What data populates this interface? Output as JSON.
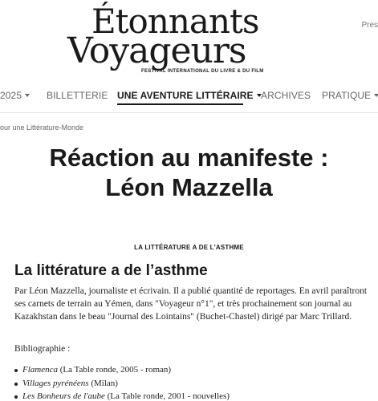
{
  "header": {
    "logo_line1": "Étonnants",
    "logo_line2": "Voyageurs",
    "logo_subtitle": "FESTIVAL INTERNATIONAL DU LIVRE & DU FILM",
    "press_link": "Pres"
  },
  "nav": {
    "items": [
      {
        "label": "2025",
        "dropdown": true
      },
      {
        "label": "BILLETTERIE",
        "dropdown": false
      },
      {
        "label": "UNE AVENTURE LITTÉRAIRE",
        "dropdown": true,
        "active": true
      },
      {
        "label": "ARCHIVES",
        "dropdown": false
      },
      {
        "label": "PRATIQUE",
        "dropdown": true
      }
    ]
  },
  "breadcrumb": "our une Littérature-Monde",
  "article": {
    "title": "Réaction au manifeste : Léon Mazzella",
    "kicker": "LA LITTÉRATURE A DE L'ASTHME",
    "heading": "La littérature a de l’asthme",
    "intro": "Par Léon Mazzella, journaliste et écrivain. Il a publié quantité de reportages. En avril paraîtront ses carnets de terrain au Yémen, dans \"Voyageur n°1\", et très prochainement son journal au Kazakhstan dans le beau \"Journal des Lointains\" (Buchet-Chastel) dirigé par Marc Trillard.",
    "bibliography_label": "Bibliographie :",
    "bibliography": [
      {
        "title": "Flamenca",
        "details": " (La Table ronde, 2005 - roman)"
      },
      {
        "title": "Villages pyrénéens",
        "details": " (Milan)"
      },
      {
        "title": "Les Bonheurs de l'aube",
        "details": " (La Table ronde, 2001 - nouvelles)"
      }
    ]
  }
}
